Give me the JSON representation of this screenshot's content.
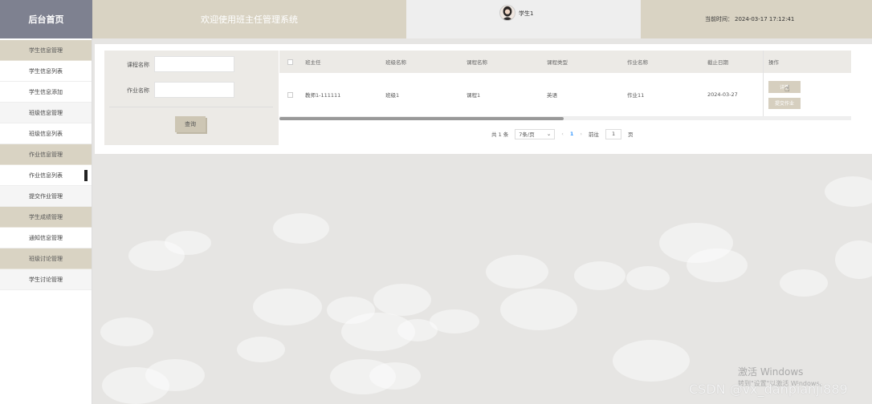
{
  "header": {
    "brand": "后台首页",
    "welcome": "欢迎使用班主任管理系统",
    "username": "学生1",
    "time_label": "当前时间：",
    "time_value": "2024-03-17 17:12:41"
  },
  "sidebar": {
    "items": [
      {
        "label": "学生信息管理",
        "type": "group"
      },
      {
        "label": "学生信息列表",
        "type": "item"
      },
      {
        "label": "学生信息添加",
        "type": "item"
      },
      {
        "label": "班级信息管理",
        "type": "group"
      },
      {
        "label": "班级信息列表",
        "type": "item"
      },
      {
        "label": "作业信息管理",
        "type": "group"
      },
      {
        "label": "作业信息列表",
        "type": "item",
        "active": true
      },
      {
        "label": "提交作业管理",
        "type": "item"
      },
      {
        "label": "学生成绩管理",
        "type": "group"
      },
      {
        "label": "通知信息管理",
        "type": "item"
      },
      {
        "label": "班级讨论管理",
        "type": "group"
      },
      {
        "label": "学生讨论管理",
        "type": "item"
      }
    ]
  },
  "search": {
    "course_label": "课程名称",
    "homework_label": "作业名称",
    "course_value": "",
    "homework_value": "",
    "query_button": "查询"
  },
  "table": {
    "headers": [
      "班主任",
      "班级名称",
      "课程名称",
      "课程类型",
      "作业名称",
      "截止日期",
      "操作"
    ],
    "rows": [
      {
        "teacher": "教师1-111111",
        "class_name": "班级1",
        "course_name": "课程1",
        "course_type": "英语",
        "homework_name": "作业11",
        "deadline": "2024-03-27",
        "actions": [
          "详情",
          "提交作业"
        ]
      }
    ]
  },
  "pagination": {
    "total": "共 1 条",
    "page_size": "7条/页",
    "current_page": "1",
    "goto_label": "前往",
    "goto_value": "1",
    "page_suffix": "页"
  },
  "watermark": {
    "windows_title": "激活 Windows",
    "windows_sub": "转到\"设置\"以激活 Windows。",
    "csdn": "CSDN @vx_danpianji889"
  },
  "colors": {
    "brand_bg": "#7e8190",
    "header_bg": "#d9d3c3",
    "user_bg": "#eeeeee",
    "button_bg": "#d6cfbf",
    "page_bg": "#e6e5e3"
  }
}
